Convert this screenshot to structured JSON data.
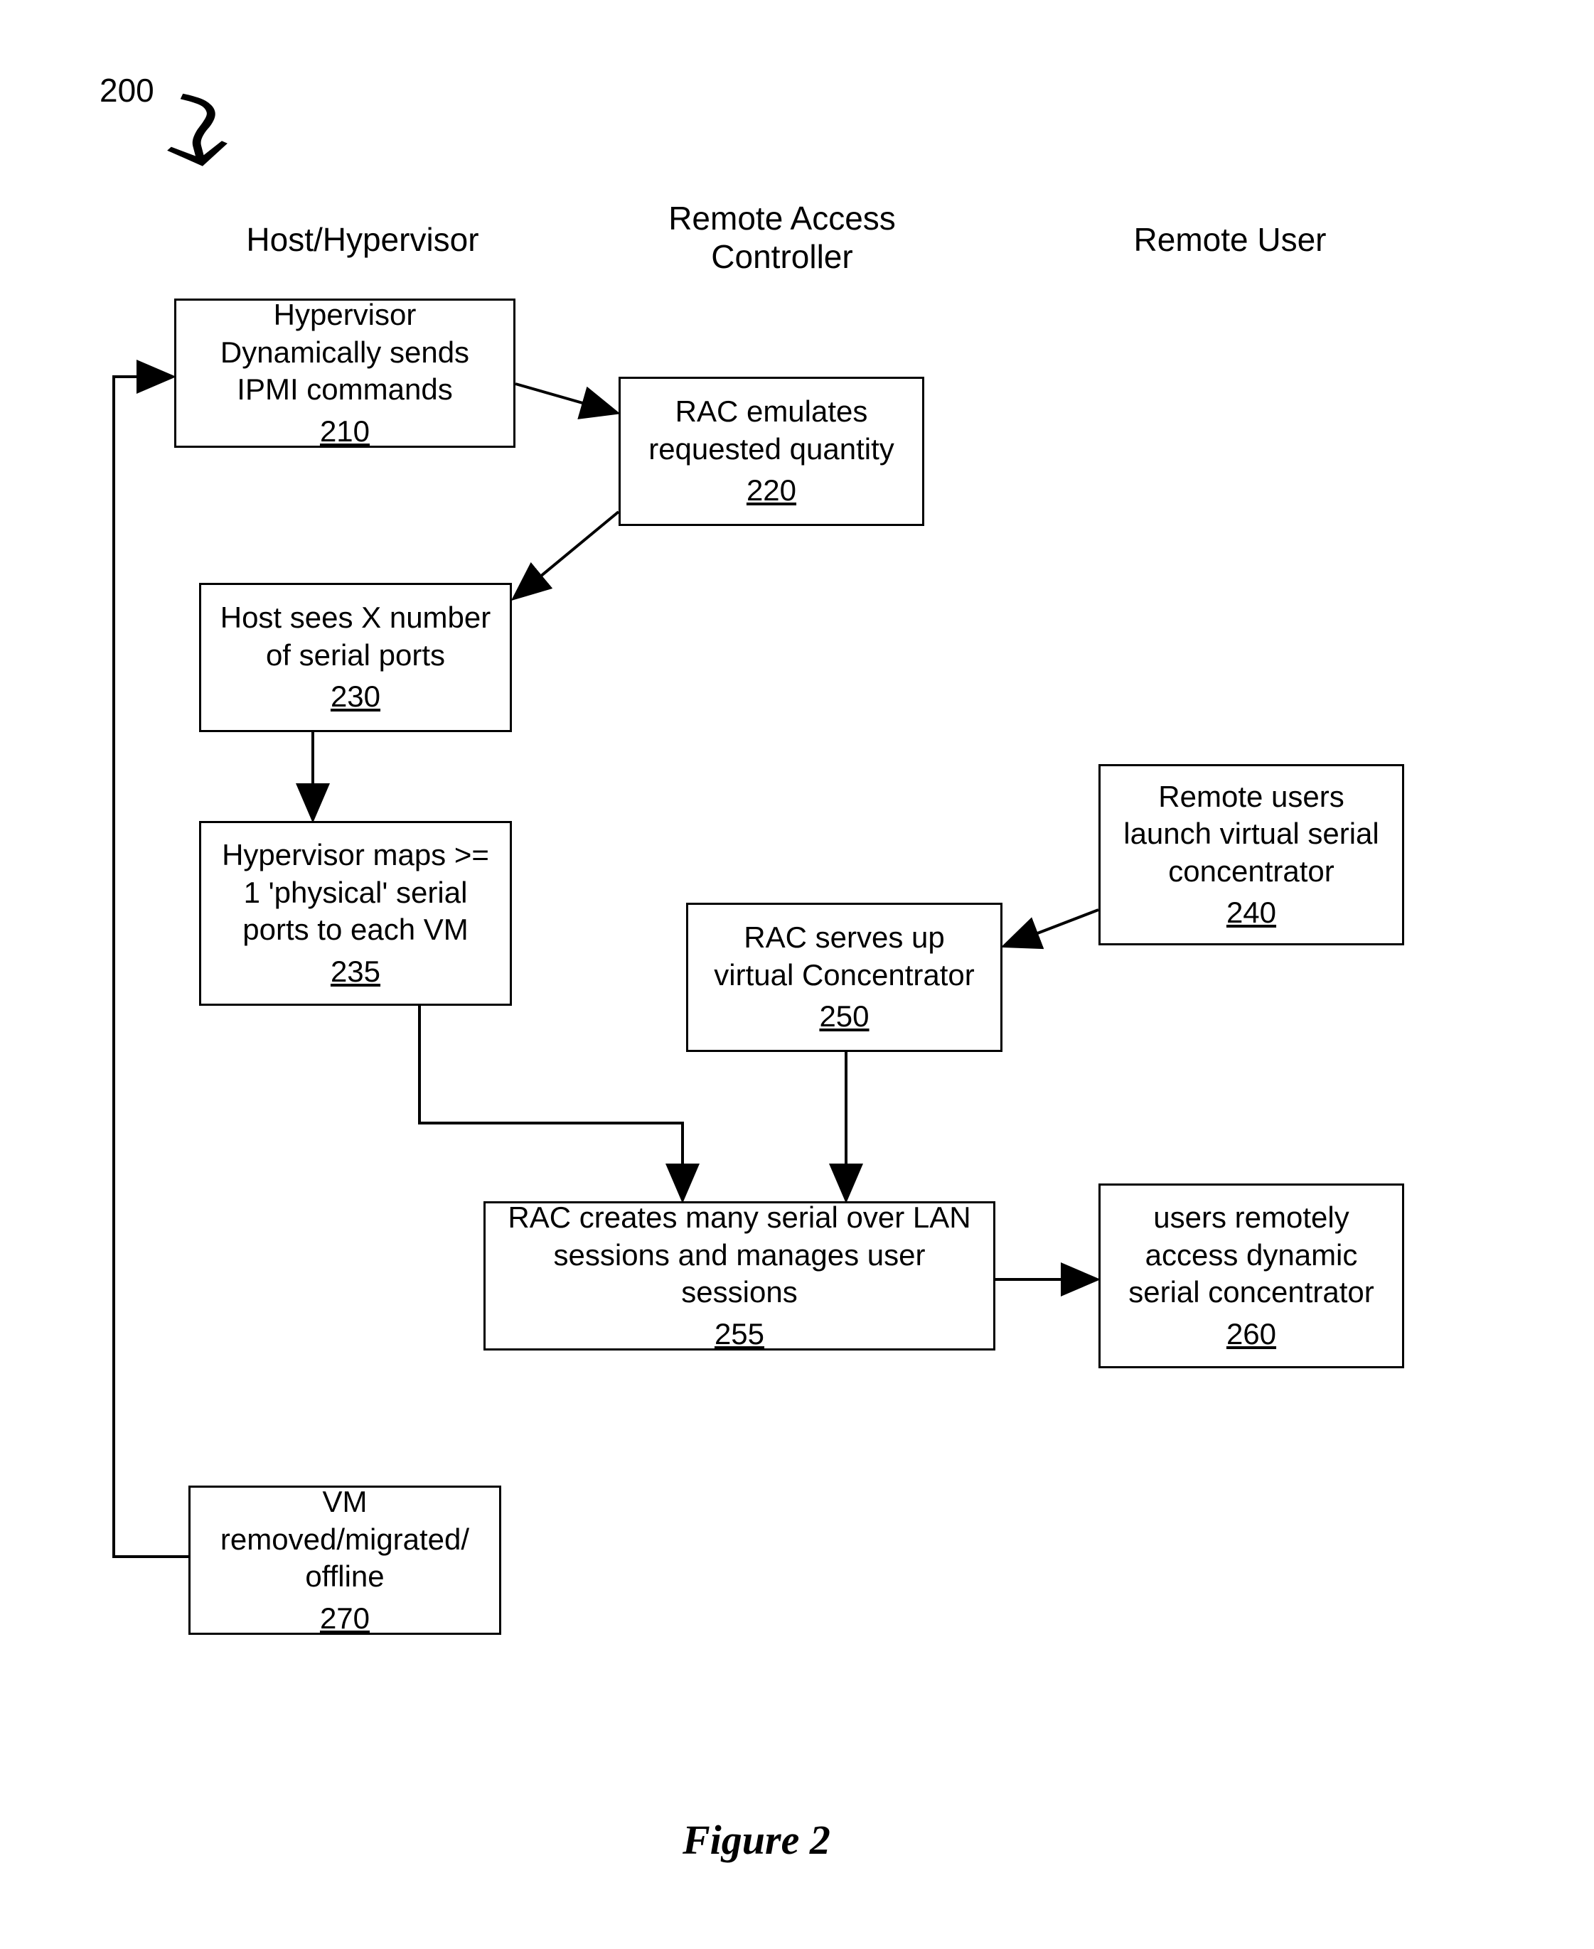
{
  "figure_number": "200",
  "columns": {
    "host": "Host/Hypervisor",
    "rac": "Remote Access\nController",
    "user": "Remote User"
  },
  "boxes": {
    "b210": {
      "text": "Hypervisor Dynamically sends IPMI commands",
      "ref": "210"
    },
    "b220": {
      "text": "RAC emulates requested quantity",
      "ref": "220"
    },
    "b230": {
      "text": "Host sees X number of serial ports",
      "ref": "230"
    },
    "b235": {
      "text": "Hypervisor maps >= 1 'physical' serial ports to each VM",
      "ref": "235"
    },
    "b240": {
      "text": "Remote users launch virtual serial concentrator",
      "ref": "240"
    },
    "b250": {
      "text": "RAC serves up virtual Concentrator",
      "ref": "250"
    },
    "b255": {
      "text": "RAC creates many serial over LAN sessions and manages user sessions",
      "ref": "255"
    },
    "b260": {
      "text": "users remotely access dynamic serial concentrator",
      "ref": "260"
    },
    "b270": {
      "text": "VM removed/migrated/ offline",
      "ref": "270"
    }
  },
  "caption": "Figure 2"
}
